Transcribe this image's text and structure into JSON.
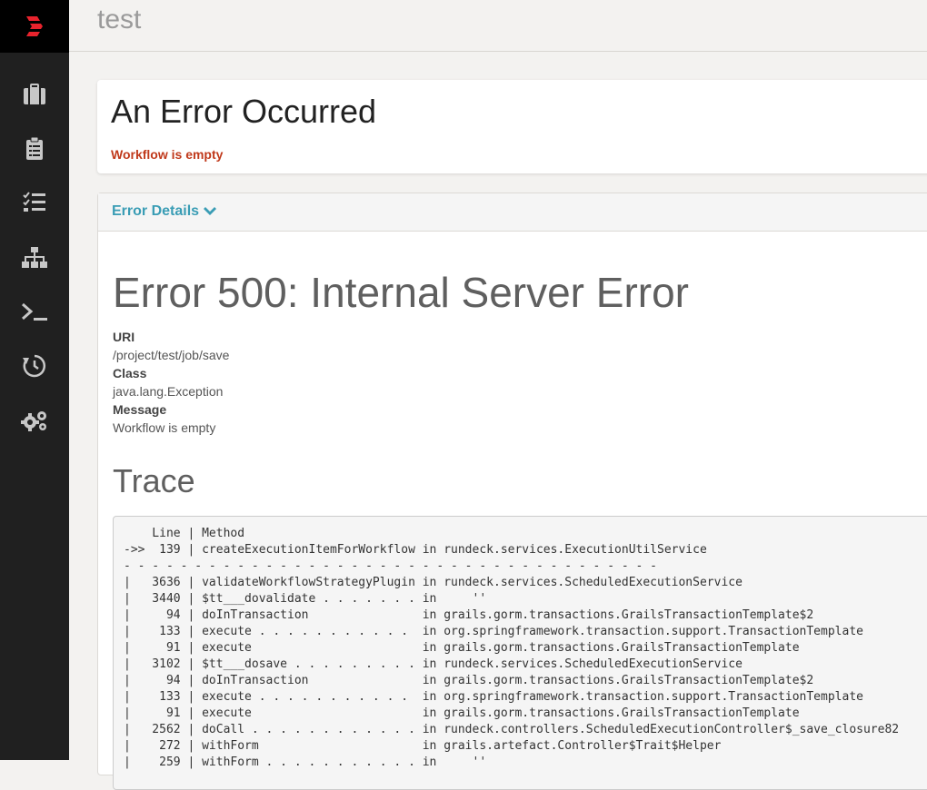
{
  "app": {
    "project_title": "test"
  },
  "sidebar": {
    "items": [
      {
        "name": "jobs",
        "icon": "briefcase-icon"
      },
      {
        "name": "activity",
        "icon": "clipboard-icon"
      },
      {
        "name": "tasks",
        "icon": "checklist-icon"
      },
      {
        "name": "nodes",
        "icon": "sitemap-icon"
      },
      {
        "name": "commands",
        "icon": "terminal-icon"
      },
      {
        "name": "history",
        "icon": "history-icon"
      },
      {
        "name": "settings",
        "icon": "gears-icon"
      }
    ]
  },
  "error": {
    "heading": "An Error Occurred",
    "summary": "Workflow is empty"
  },
  "details": {
    "toggle_label": "Error Details",
    "code_heading": "Error 500: Internal Server Error",
    "uri_label": "URI",
    "uri_value": "/project/test/job/save",
    "class_label": "Class",
    "class_value": "java.lang.Exception",
    "message_label": "Message",
    "message_value": "Workflow is empty",
    "trace_heading": "Trace",
    "trace_lines": [
      "    Line | Method",
      "->>  139 | createExecutionItemForWorkflow in rundeck.services.ExecutionUtilService",
      "- - - - - - - - - - - - - - - - - - - - - - - - - - - - - - - - - - - - - -",
      "|   3636 | validateWorkflowStrategyPlugin in rundeck.services.ScheduledExecutionService",
      "|   3440 | $tt___dovalidate . . . . . . . in     ''",
      "|     94 | doInTransaction                in grails.gorm.transactions.GrailsTransactionTemplate$2",
      "|    133 | execute . . . . . . . . . . .  in org.springframework.transaction.support.TransactionTemplate",
      "|     91 | execute                        in grails.gorm.transactions.GrailsTransactionTemplate",
      "|   3102 | $tt___dosave . . . . . . . . . in rundeck.services.ScheduledExecutionService",
      "|     94 | doInTransaction                in grails.gorm.transactions.GrailsTransactionTemplate$2",
      "|    133 | execute . . . . . . . . . . .  in org.springframework.transaction.support.TransactionTemplate",
      "|     91 | execute                        in grails.gorm.transactions.GrailsTransactionTemplate",
      "|   2562 | doCall . . . . . . . . . . . . in rundeck.controllers.ScheduledExecutionController$_save_closure82",
      "|    272 | withForm                       in grails.artefact.Controller$Trait$Helper",
      "|    259 | withForm . . . . . . . . . . . in     ''"
    ]
  }
}
